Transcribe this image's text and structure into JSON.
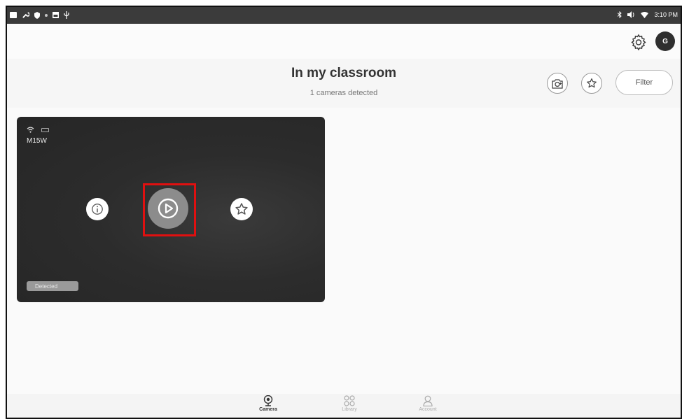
{
  "status_bar": {
    "time": "3:10 PM",
    "icons": [
      "square-icon",
      "wrench-icon",
      "shield-icon",
      "dot-icon",
      "image-icon",
      "usb-icon",
      "bluetooth-icon",
      "volume-icon",
      "wifi-icon"
    ]
  },
  "top_bar": {
    "avatar_initial": "G",
    "icons": [
      "gear-icon"
    ]
  },
  "header": {
    "title": "In my classroom",
    "subtitle": "1 cameras detected",
    "filter_label": "Filter",
    "icons": [
      "camera-add-icon",
      "star-icon"
    ]
  },
  "camera_card": {
    "name": "M15W",
    "status_badge": "Detected",
    "icons": [
      "wifi-icon",
      "battery-icon",
      "info-icon",
      "play-icon",
      "star-icon"
    ],
    "highlight_color": "#e01010"
  },
  "bottom_nav": {
    "items": [
      {
        "label": "Camera",
        "icon": "webcam-icon",
        "active": true
      },
      {
        "label": "Library",
        "icon": "grid-circles-icon",
        "active": false
      },
      {
        "label": "Account",
        "icon": "person-icon",
        "active": false
      }
    ]
  }
}
